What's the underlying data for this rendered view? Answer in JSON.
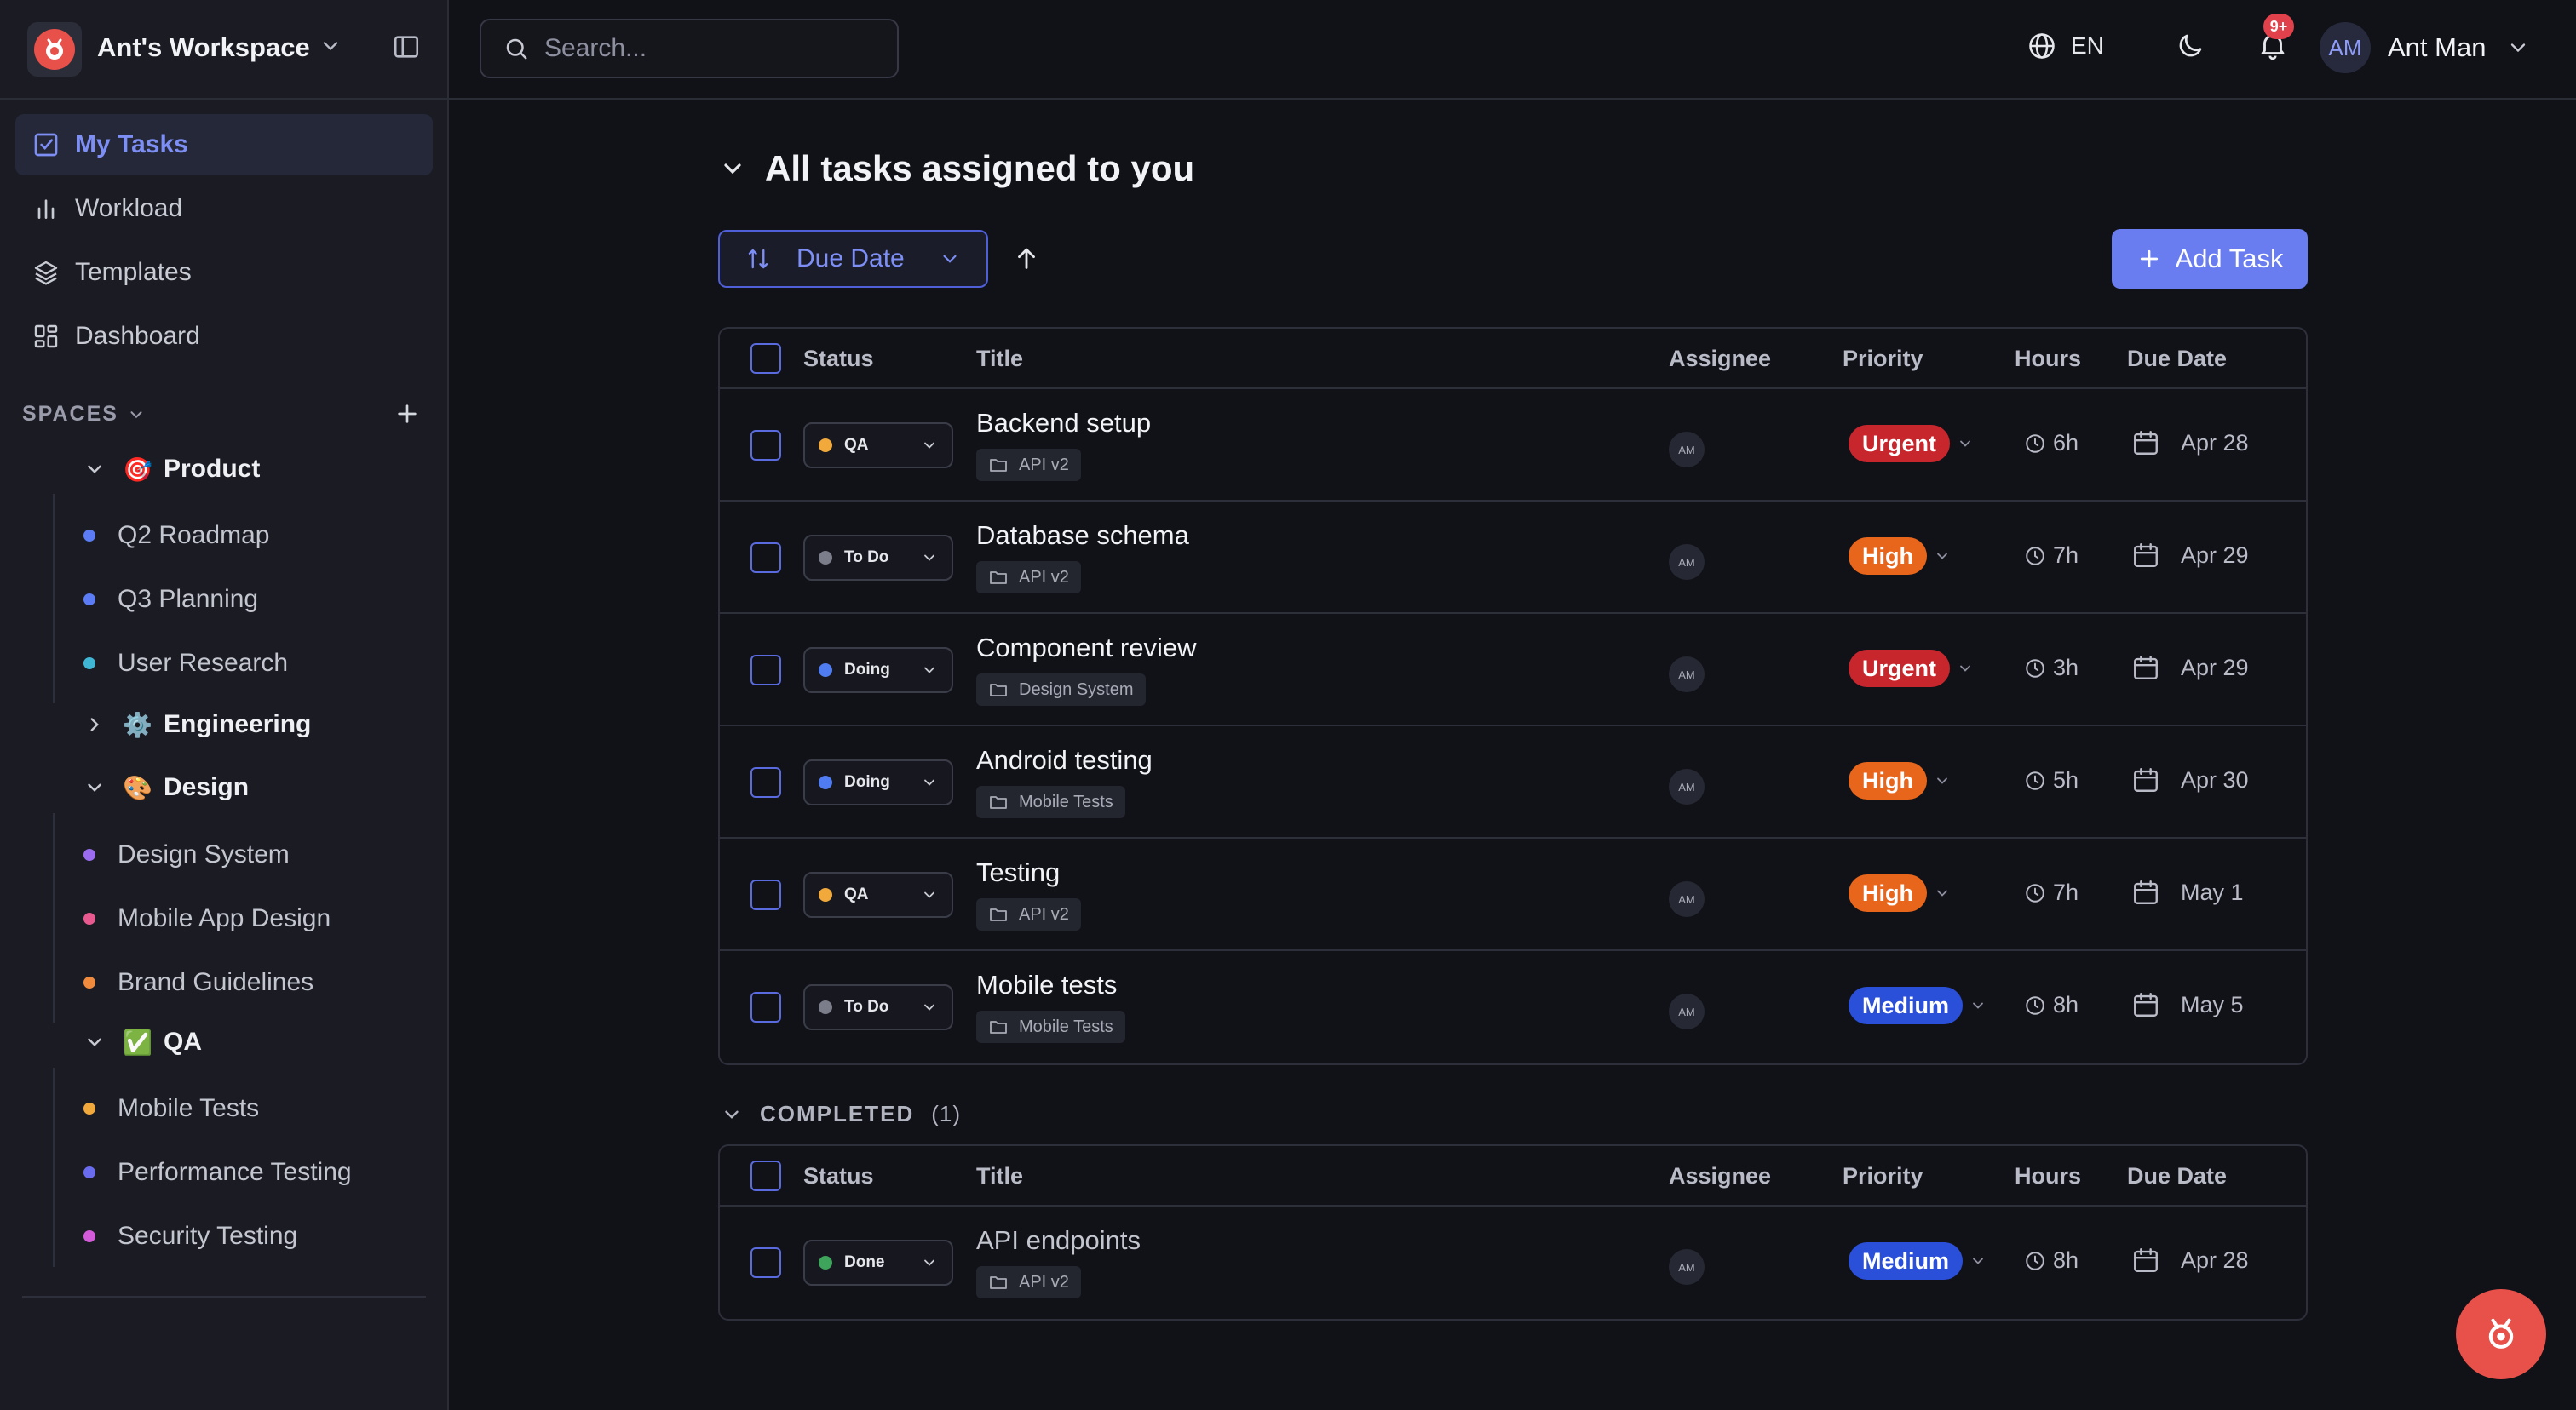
{
  "workspace": {
    "name": "Ant's Workspace"
  },
  "nav": [
    {
      "label": "My Tasks",
      "icon": "check-square-icon",
      "active": true
    },
    {
      "label": "Workload",
      "icon": "bar-chart-icon"
    },
    {
      "label": "Templates",
      "icon": "layers-icon"
    },
    {
      "label": "Dashboard",
      "icon": "dashboard-icon"
    }
  ],
  "spaces": {
    "label": "SPACES",
    "groups": [
      {
        "name": "Product",
        "emoji": "🎯",
        "expanded": true,
        "items": [
          {
            "label": "Q2 Roadmap",
            "color": "#5b7cf5"
          },
          {
            "label": "Q3 Planning",
            "color": "#5b7cf5"
          },
          {
            "label": "User Research",
            "color": "#3fb6d4"
          }
        ]
      },
      {
        "name": "Engineering",
        "emoji": "⚙️",
        "expanded": false,
        "items": []
      },
      {
        "name": "Design",
        "emoji": "🎨",
        "expanded": true,
        "items": [
          {
            "label": "Design System",
            "color": "#9b6cf0"
          },
          {
            "label": "Mobile App Design",
            "color": "#e85a8f"
          },
          {
            "label": "Brand Guidelines",
            "color": "#f08a3c"
          }
        ]
      },
      {
        "name": "QA",
        "emoji": "✅",
        "expanded": true,
        "items": [
          {
            "label": "Mobile Tests",
            "color": "#f2a93b"
          },
          {
            "label": "Performance Testing",
            "color": "#6a6cf0"
          },
          {
            "label": "Security Testing",
            "color": "#d35ad8"
          }
        ]
      }
    ]
  },
  "topbar": {
    "search_placeholder": "Search...",
    "language": "EN",
    "notifications_badge": "9+",
    "user": {
      "initials": "AM",
      "name": "Ant Man"
    }
  },
  "main": {
    "section_title": "All tasks assigned to you",
    "sort_label": "Due Date",
    "add_task_label": "Add Task"
  },
  "table_headers": {
    "status": "Status",
    "title": "Title",
    "assignee": "Assignee",
    "priority": "Priority",
    "hours": "Hours",
    "due": "Due Date"
  },
  "tasks": [
    {
      "status": "QA",
      "status_color": "#f2a93b",
      "title": "Backend setup",
      "project": "API v2",
      "assignee": "AM",
      "priority": "Urgent",
      "priority_color": "#c8262d",
      "hours": "6h",
      "due": "Apr 28"
    },
    {
      "status": "To Do",
      "status_color": "#7b7d8a",
      "title": "Database schema",
      "project": "API v2",
      "assignee": "AM",
      "priority": "High",
      "priority_color": "#e8651c",
      "hours": "7h",
      "due": "Apr 29"
    },
    {
      "status": "Doing",
      "status_color": "#4f7cf0",
      "title": "Component review",
      "project": "Design System",
      "assignee": "AM",
      "priority": "Urgent",
      "priority_color": "#c8262d",
      "hours": "3h",
      "due": "Apr 29"
    },
    {
      "status": "Doing",
      "status_color": "#4f7cf0",
      "title": "Android testing",
      "project": "Mobile Tests",
      "assignee": "AM",
      "priority": "High",
      "priority_color": "#e8651c",
      "hours": "5h",
      "due": "Apr 30"
    },
    {
      "status": "QA",
      "status_color": "#f2a93b",
      "title": "Testing",
      "project": "API v2",
      "assignee": "AM",
      "priority": "High",
      "priority_color": "#e8651c",
      "hours": "7h",
      "due": "May 1"
    },
    {
      "status": "To Do",
      "status_color": "#7b7d8a",
      "title": "Mobile tests",
      "project": "Mobile Tests",
      "assignee": "AM",
      "priority": "Medium",
      "priority_color": "#2a4fd8",
      "hours": "8h",
      "due": "May 5"
    }
  ],
  "completed": {
    "label": "COMPLETED",
    "count": "(1)",
    "tasks": [
      {
        "status": "Done",
        "status_color": "#3fa45b",
        "title": "API endpoints",
        "project": "API v2",
        "assignee": "AM",
        "priority": "Medium",
        "priority_color": "#2a4fd8",
        "hours": "8h",
        "due": "Apr 28"
      }
    ]
  }
}
